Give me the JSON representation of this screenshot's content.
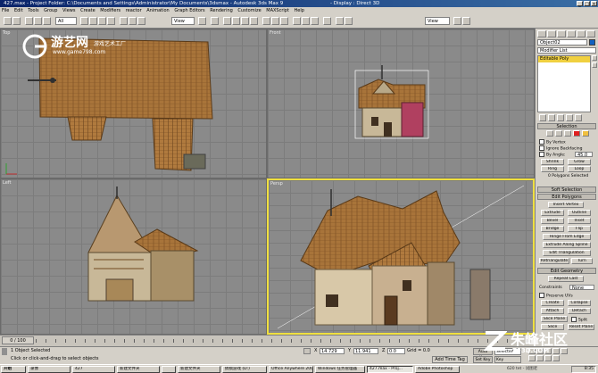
{
  "window": {
    "title_left": "427.max - Project Folder: C:\\Documents and Settings\\Administrator\\My Documents\\3dsmax - Autodesk 3ds Max 9",
    "title_right": "- Display : Direct 3D"
  },
  "menu": [
    "File",
    "Edit",
    "Tools",
    "Group",
    "Views",
    "Create",
    "Modifiers",
    "reactor",
    "Animation",
    "Graph Editors",
    "Rendering",
    "Customize",
    "MAXScript",
    "Help"
  ],
  "toolbar": {
    "selection_filter": "All",
    "ref_coord": "View",
    "named_sel": "View"
  },
  "viewports": {
    "top": "Top",
    "front": "Front",
    "left": "Left",
    "perspective": "Persp"
  },
  "watermark_top": {
    "brand_cn": "游艺网",
    "sub_cn": "游戏艺术工厂",
    "url": "www.game798.com"
  },
  "command_panel": {
    "object_name": "Object02",
    "modifier_list": "Modifier List",
    "stack_item": "Editable Poly",
    "selection_rollout": "Selection",
    "by_vertex": "By Vertex",
    "ignore_backfacing": "Ignore Backfacing",
    "by_angle": "By Angle:",
    "by_angle_value": "45.0",
    "shrink": "Shrink",
    "grow": "Grow",
    "ring": "Ring",
    "loop": "Loop",
    "sel_info": "0 Polygons Selected",
    "soft_selection": "Soft Selection",
    "edit_polygons": "Edit Polygons",
    "insert_vertex": "Insert Vertex",
    "extrude": "Extrude",
    "outline": "Outline",
    "bevel": "Bevel",
    "inset": "Inset",
    "bridge": "Bridge",
    "flip": "Flip",
    "hinge": "Hinge From Edge",
    "extrude_spline": "Extrude Along Spline",
    "edit_tri": "Edit Triangulation",
    "retriangulate": "Retriangulate",
    "turn": "Turn",
    "edit_geometry": "Edit Geometry",
    "repeat_last": "Repeat Last",
    "constraints": "Constraints",
    "constraints_value": "None",
    "preserve_uvs": "Preserve UVs",
    "create": "Create",
    "collapse": "Collapse",
    "attach": "Attach",
    "detach": "Detach",
    "slice_plane": "Slice Plane",
    "split": "Split",
    "slice": "Slice",
    "reset_plane": "Reset Plane"
  },
  "timeline": {
    "frame": "0 / 100"
  },
  "status": {
    "selected": "1 Object Selected",
    "prompt": "Click or click-and-drag to select objects",
    "x_label": "X",
    "x_value": "14.729",
    "y_label": "Y",
    "y_value": "11.941",
    "z_label": "Z",
    "z_value": "0.0",
    "grid": "Grid = 0.0",
    "add_time_tag": "Add Time Tag",
    "auto_key": "Auto Key",
    "auto_key_mode": "Selected",
    "set_key": "Set Key",
    "key_filters": "Key Filters..."
  },
  "taskbar": [
    "开始",
    "录像",
    "427",
    "新建文件夹",
    "",
    "新建文件夹",
    "搞搞游戏 (D:)",
    "Office Anywhere 200...",
    "Windows 任务管理器",
    "427.max - Proj...",
    "Adobe Photoshop"
  ],
  "tray_time": "8:35",
  "watermark_bottom": {
    "brand_cn": "朱峰社区",
    "url": "ZF3D.COM",
    "note": "620 tet - 试图老"
  },
  "colors": {
    "title": "#0a246a",
    "viewport_bg": "#8a8a8a",
    "active_viewport": "#f0e040",
    "stack_item": "#f0d040"
  }
}
